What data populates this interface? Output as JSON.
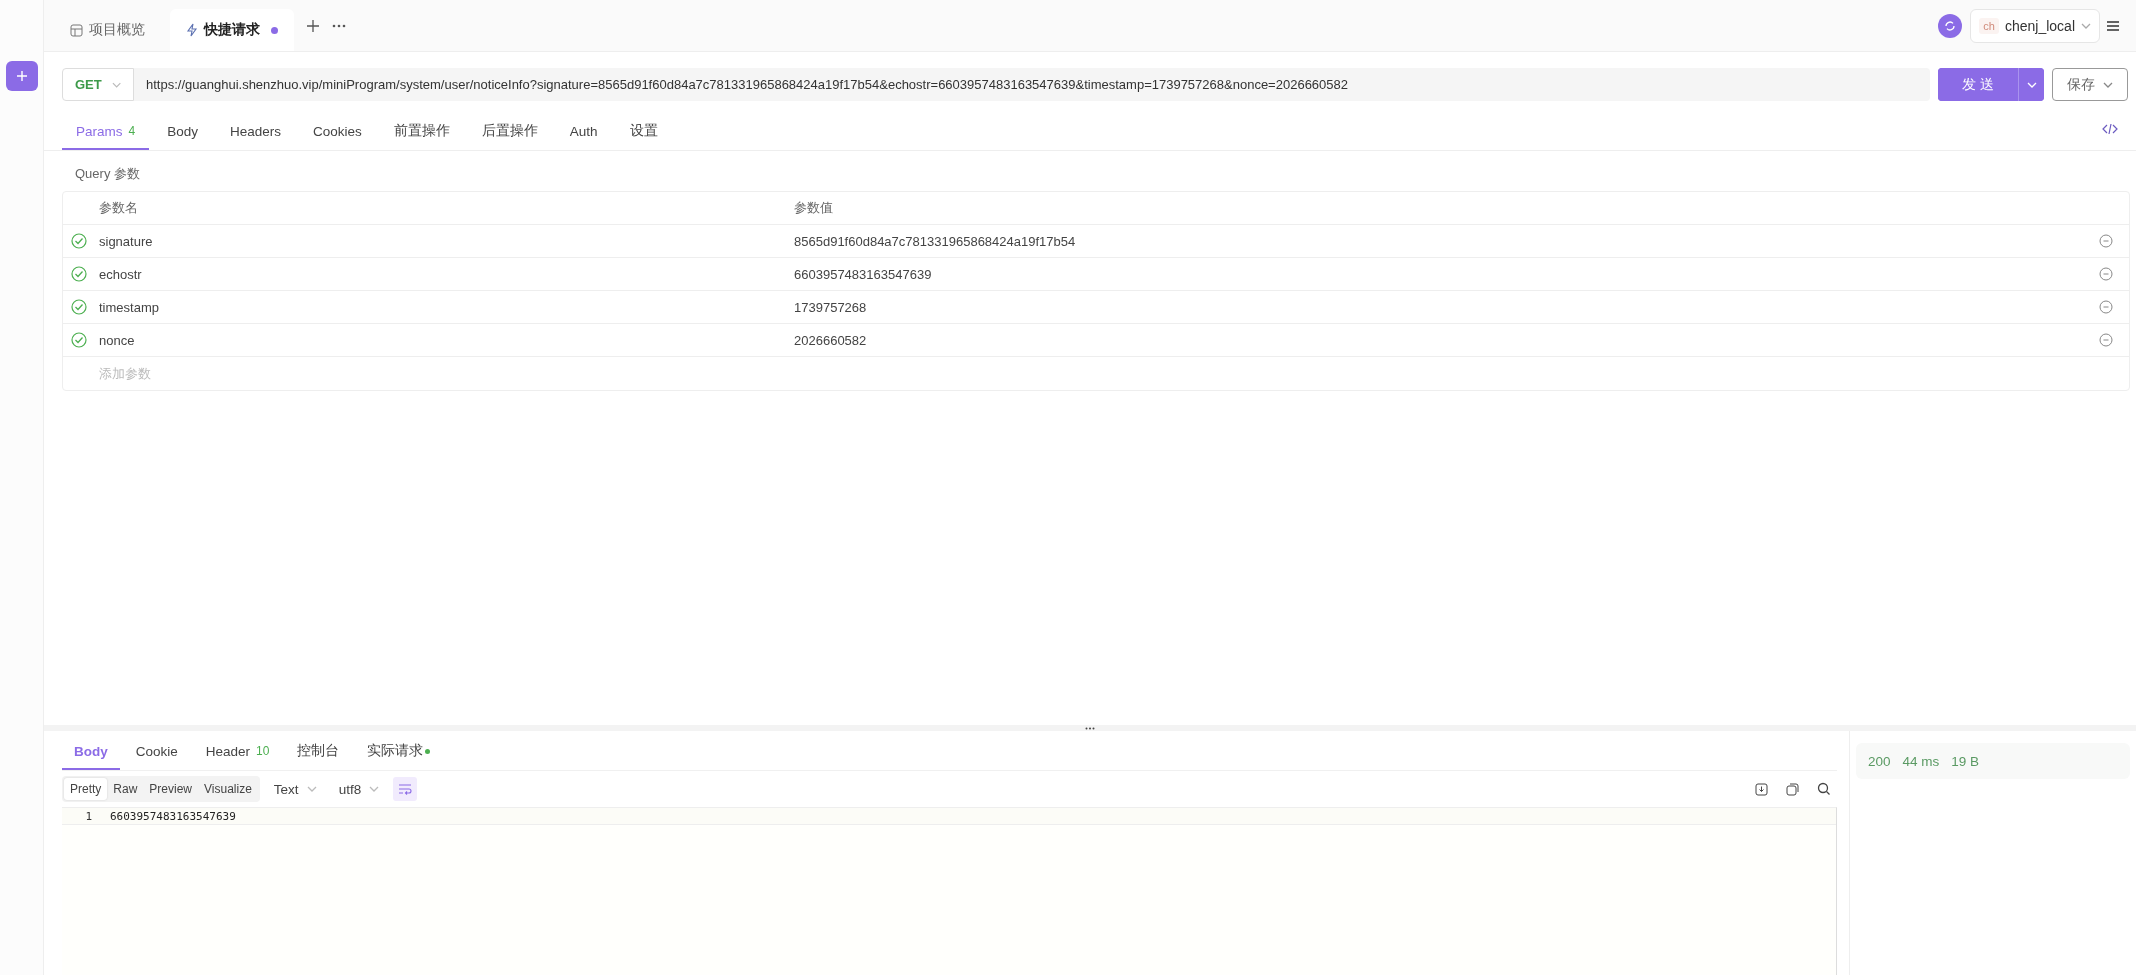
{
  "tabs": [
    {
      "label": "项目概览",
      "kind": "overview",
      "selected": false,
      "modified": false
    },
    {
      "label": "快捷请求",
      "kind": "quick",
      "selected": true,
      "modified": true
    }
  ],
  "environment": {
    "avatar": "ch",
    "name": "chenj_local"
  },
  "request": {
    "method": "GET",
    "url": "https://guanghui.shenzhuo.vip/miniProgram/system/user/noticeInfo?signature=8565d91f60d84a7c781331965868424a19f17b54&echostr=6603957483163547639&timestamp=1739757268&nonce=2026660582",
    "send": "发 送",
    "save": "保存"
  },
  "request_tabs": [
    {
      "label": "Params",
      "count": "4",
      "selected": true
    },
    {
      "label": "Body",
      "selected": false
    },
    {
      "label": "Headers",
      "selected": false
    },
    {
      "label": "Cookies",
      "selected": false
    },
    {
      "label": "前置操作",
      "selected": false
    },
    {
      "label": "后置操作",
      "selected": false
    },
    {
      "label": "Auth",
      "selected": false
    },
    {
      "label": "设置",
      "selected": false
    }
  ],
  "query": {
    "title": "Query 参数",
    "columns": [
      "参数名",
      "参数值"
    ],
    "rows": [
      {
        "enabled": true,
        "name": "signature",
        "value": "8565d91f60d84a7c781331965868424a19f17b54"
      },
      {
        "enabled": true,
        "name": "echostr",
        "value": "6603957483163547639"
      },
      {
        "enabled": true,
        "name": "timestamp",
        "value": "1739757268"
      },
      {
        "enabled": true,
        "name": "nonce",
        "value": "2026660582"
      }
    ],
    "placeholder": "添加参数"
  },
  "response": {
    "tabs": [
      {
        "label": "Body",
        "selected": true
      },
      {
        "label": "Cookie",
        "selected": false
      },
      {
        "label": "Header",
        "count": "10",
        "selected": false
      },
      {
        "label": "控制台",
        "selected": false
      },
      {
        "label": "实际请求",
        "dot": true,
        "selected": false
      }
    ],
    "views": [
      {
        "label": "Pretty",
        "selected": true
      },
      {
        "label": "Raw",
        "selected": false
      },
      {
        "label": "Preview",
        "selected": false
      },
      {
        "label": "Visualize",
        "selected": false
      }
    ],
    "format": "Text",
    "encoding": "utf8",
    "line_wrap": true,
    "lines": [
      {
        "number": "1",
        "text": "6603957483163547639"
      }
    ],
    "status": {
      "code": "200",
      "time": "44 ms",
      "size": "19 B"
    }
  }
}
